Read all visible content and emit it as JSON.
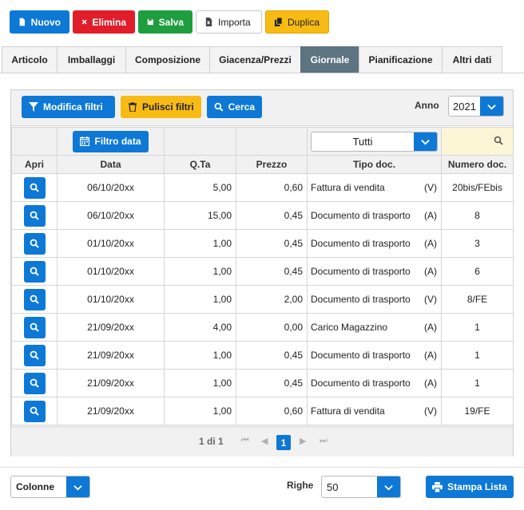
{
  "toolbar": {
    "nuovo": "Nuovo",
    "elimina": "Elimina",
    "salva": "Salva",
    "importa": "Importa",
    "duplica": "Duplica"
  },
  "tabs": [
    {
      "label": "Articolo",
      "active": false
    },
    {
      "label": "Imballaggi",
      "active": false
    },
    {
      "label": "Composizione",
      "active": false
    },
    {
      "label": "Giacenza/Prezzi",
      "active": false
    },
    {
      "label": "Giornale",
      "active": true
    },
    {
      "label": "Pianificazione",
      "active": false
    },
    {
      "label": "Altri dati",
      "active": false
    }
  ],
  "filters": {
    "modifica": "Modifica filtri",
    "pulisci": "Pulisci filtri",
    "cerca": "Cerca",
    "anno_label": "Anno",
    "anno_value": "2021",
    "filtro_data": "Filtro data",
    "tipo_select": "Tutti"
  },
  "columns": {
    "apri": "Apri",
    "data": "Data",
    "qta": "Q.Ta",
    "prezzo": "Prezzo",
    "tipo": "Tipo doc.",
    "numero": "Numero doc."
  },
  "rows": [
    {
      "data": "06/10/20xx",
      "qta": "5,00",
      "prezzo": "0,60",
      "tipo": "Fattura di vendita",
      "flag": "(V)",
      "numero": "20bis/FEbis"
    },
    {
      "data": "06/10/20xx",
      "qta": "15,00",
      "prezzo": "0,45",
      "tipo": "Documento di trasporto",
      "flag": "(A)",
      "numero": "8"
    },
    {
      "data": "01/10/20xx",
      "qta": "1,00",
      "prezzo": "0,45",
      "tipo": "Documento di trasporto",
      "flag": "(A)",
      "numero": "3"
    },
    {
      "data": "01/10/20xx",
      "qta": "1,00",
      "prezzo": "0,45",
      "tipo": "Documento di trasporto",
      "flag": "(A)",
      "numero": "6"
    },
    {
      "data": "01/10/20xx",
      "qta": "1,00",
      "prezzo": "2,00",
      "tipo": "Documento di trasporto",
      "flag": "(V)",
      "numero": "8/FE"
    },
    {
      "data": "21/09/20xx",
      "qta": "4,00",
      "prezzo": "0,00",
      "tipo": "Carico Magazzino",
      "flag": "(A)",
      "numero": "1"
    },
    {
      "data": "21/09/20xx",
      "qta": "1,00",
      "prezzo": "0,45",
      "tipo": "Documento di trasporto",
      "flag": "(A)",
      "numero": "1"
    },
    {
      "data": "21/09/20xx",
      "qta": "1,00",
      "prezzo": "0,45",
      "tipo": "Documento di trasporto",
      "flag": "(A)",
      "numero": "1"
    },
    {
      "data": "21/09/20xx",
      "qta": "1,00",
      "prezzo": "0,60",
      "tipo": "Fattura di vendita",
      "flag": "(V)",
      "numero": "19/FE"
    }
  ],
  "pager": {
    "info": "1 di 1",
    "current": "1"
  },
  "bottom": {
    "colonne": "Colonne",
    "righe_label": "Righe",
    "righe_value": "50",
    "stampa": "Stampa Lista"
  },
  "colors": {
    "primary": "#0d78d6",
    "danger": "#e21d2a",
    "success": "#1e9e3e",
    "warning": "#f7bb14",
    "active_tab": "#5d7481"
  }
}
